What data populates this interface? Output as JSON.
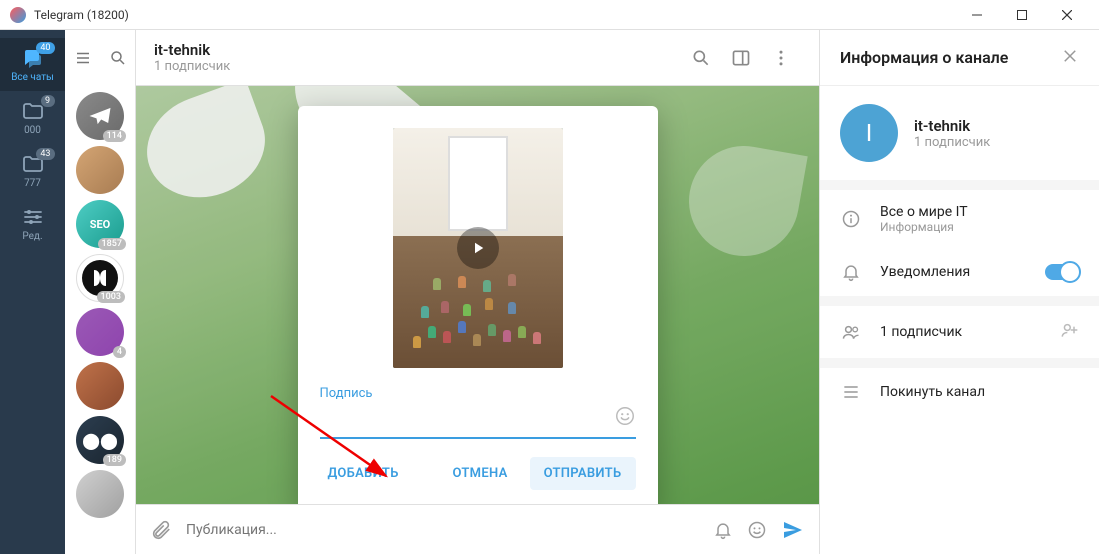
{
  "window": {
    "title": "Telegram (18200)"
  },
  "rail": {
    "items": [
      {
        "label": "Все чаты",
        "badge": "40"
      },
      {
        "label": "000",
        "badge": "9"
      },
      {
        "label": "777",
        "badge": "43"
      },
      {
        "label": "Ред.",
        "badge": ""
      }
    ]
  },
  "chatlist": {
    "avatars": [
      {
        "count": "114"
      },
      {
        "count": ""
      },
      {
        "count": "1857",
        "text": "SEO"
      },
      {
        "count": "1003"
      },
      {
        "count": "4"
      },
      {
        "count": ""
      },
      {
        "count": "189"
      },
      {
        "count": ""
      }
    ]
  },
  "chat": {
    "title": "it-tehnik",
    "subtitle": "1 подписчик",
    "composer_placeholder": "Публикация..."
  },
  "modal": {
    "caption_label": "Подпись",
    "add": "ДОБАВИТЬ",
    "cancel": "ОТМЕНА",
    "send": "ОТПРАВИТЬ"
  },
  "info": {
    "header": "Информация о канале",
    "avatar_letter": "I",
    "name": "it-tehnik",
    "subscribers": "1 подписчик",
    "about_title": "Все о мире IT",
    "about_sub": "Информация",
    "notifications": "Уведомления",
    "members": "1 подписчик",
    "leave": "Покинуть канал"
  }
}
